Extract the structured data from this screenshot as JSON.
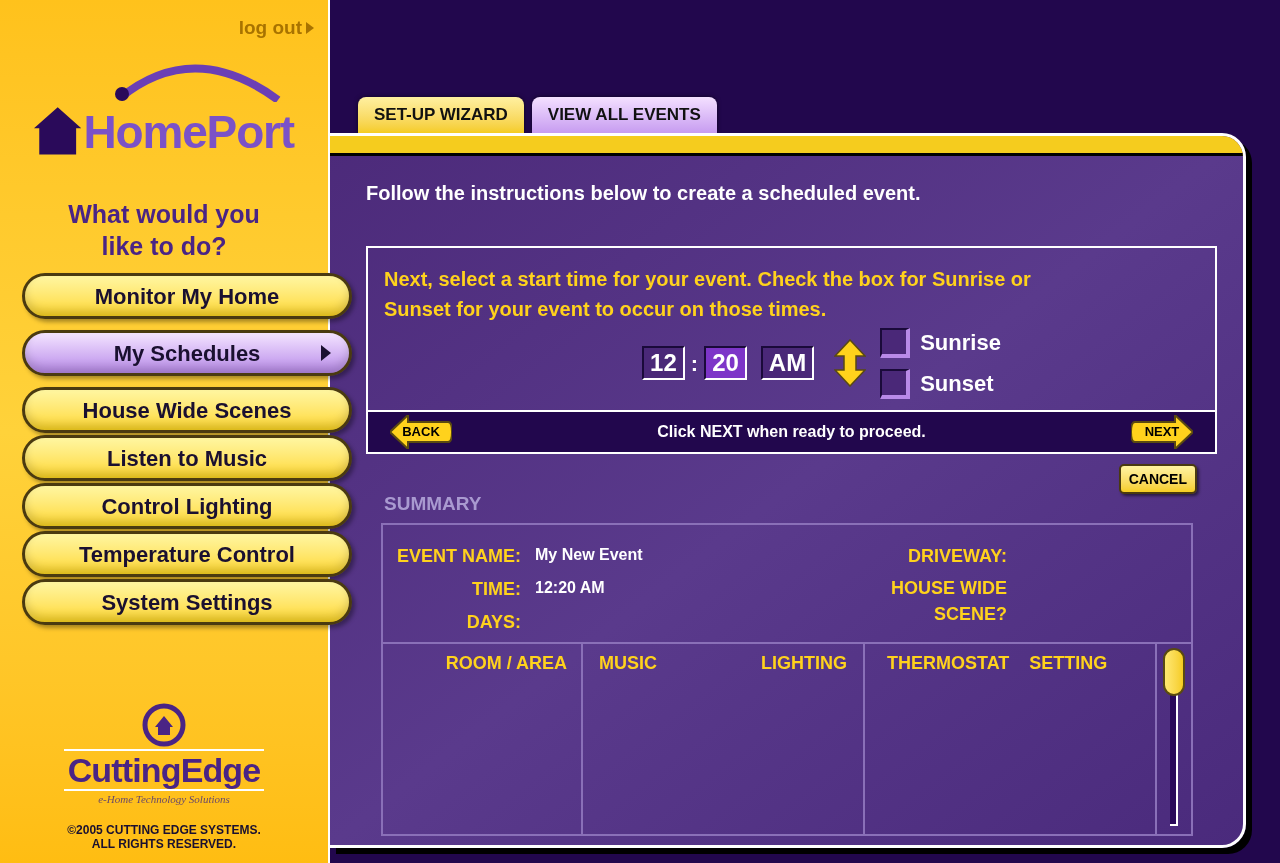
{
  "sidebar": {
    "logout": "log out",
    "logo": "HomePort",
    "prompt": "What would you like to do?",
    "items": [
      {
        "label": "Monitor My Home",
        "selected": false
      },
      {
        "label": "My Schedules",
        "selected": true
      },
      {
        "label": "House Wide Scenes",
        "selected": false
      },
      {
        "label": "Listen to Music",
        "selected": false
      },
      {
        "label": "Control Lighting",
        "selected": false
      },
      {
        "label": "Temperature Control",
        "selected": false
      },
      {
        "label": "System Settings",
        "selected": false
      }
    ],
    "brand": "CuttingEdge",
    "tagline": "e-Home Technology Solutions",
    "copyright": "©2005 CUTTING EDGE SYSTEMS.\nALL RIGHTS RESERVED."
  },
  "tabs": [
    {
      "label": "SET-UP WIZARD",
      "selected": true
    },
    {
      "label": "VIEW ALL EVENTS",
      "selected": false
    }
  ],
  "intro": "Follow the instructions below to create a scheduled event.",
  "step": {
    "instruction": "Next, select a start time for your event. Check the box for Sunrise or Sunset for your event to occur on those times.",
    "time_fields": [
      {
        "value": "12",
        "selected": false
      },
      {
        "value": "20",
        "selected": true
      },
      {
        "value": "AM",
        "selected": false
      }
    ],
    "separator": ":",
    "options": [
      {
        "label": "Sunrise",
        "checked": false
      },
      {
        "label": "Sunset",
        "checked": false
      }
    ],
    "back": "BACK",
    "hint": "Click NEXT when ready to proceed.",
    "next": "NEXT"
  },
  "cancel": "CANCEL",
  "summary": {
    "title": "SUMMARY",
    "left": [
      {
        "label": "EVENT NAME:",
        "value": "My New Event"
      },
      {
        "label": "TIME:",
        "value": "12:20 AM"
      },
      {
        "label": "DAYS:"
      }
    ],
    "right": [
      {
        "label": "DRIVEWAY:"
      },
      {
        "label": "HOUSE WIDE\nSCENE?"
      }
    ],
    "columns": [
      "ROOM / AREA",
      "MUSIC",
      "LIGHTING",
      "THERMOSTAT",
      "SETTING"
    ]
  }
}
